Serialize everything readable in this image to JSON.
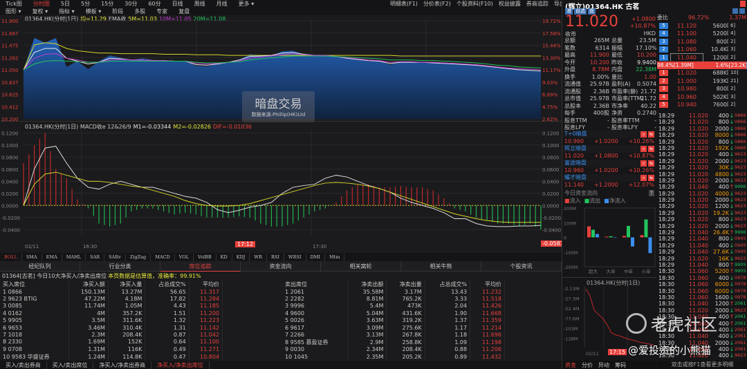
{
  "nav": {
    "tabs": [
      "Tick图",
      "分时图",
      "5日",
      "5分",
      "15分",
      "30分",
      "60分",
      "日线",
      "周线",
      "月线",
      "更多 ▾"
    ],
    "active": 1,
    "row2": [
      "图形 ▾",
      "复权 ▾",
      "指标 ▾",
      "模板 ▾",
      "阶段",
      "多股",
      "专家",
      "复盘"
    ],
    "right": [
      "明细表(F1)",
      "分价表(F2)",
      "个股资料(F10)",
      "权益披露",
      "券商追踪",
      "导出",
      ">>"
    ]
  },
  "price_chart": {
    "legend_code": "01364.HK(分时|1日)",
    "legend_avg": "均=11.29",
    "legend_ema": "EMA收",
    "legend_5m": "5M=11.03",
    "legend_10m": "10M=11.05",
    "legend_20m": "20M=11.08",
    "watermark_title": "暗盘交易",
    "watermark_sub": "数据来源:Phillip(HK)Ltd"
  },
  "macd": {
    "legend_code": "01364.HK(分时|1日) MACD收e 12&26/9",
    "m1": "M1=-0.03344",
    "m2": "M2=-0.02826",
    "dif": "DIF=-0.01036",
    "cursor_time": "17:12",
    "cursor_value": "-0.0581",
    "x_labels": [
      "02/11",
      "16:30",
      "17:30"
    ]
  },
  "chart_data": [
    {
      "type": "line",
      "title": "01364.HK 分时",
      "ylim": [
        10.2,
        11.9
      ],
      "yticks": [
        "11.900",
        "11.687",
        "11.475",
        "11.262",
        "11.050",
        "10.837",
        "10.625",
        "10.412",
        "10.200"
      ],
      "pct_ticks": [
        "19.72%",
        "17.58%",
        "15.44%",
        "13.30%",
        "11.17%",
        "9.03%",
        "6.89%",
        "4.75%",
        "2.62%"
      ],
      "series": [
        {
          "name": "price",
          "color": "#2f7fd6",
          "values": [
            11.05,
            11.6,
            11.52,
            11.6,
            11.1,
            11.2,
            11.06,
            11.2,
            11.3,
            11.26,
            11.22,
            11.25,
            11.22,
            11.21,
            11.2,
            11.2,
            11.12,
            11.11,
            11.15,
            11.18,
            11.22,
            11.32,
            11.3,
            11.29,
            11.37,
            11.38,
            11.32,
            11.3,
            11.3,
            11.29,
            11.25,
            11.24,
            11.2,
            11.2,
            11.14,
            11.19,
            11.19,
            11.19,
            11.18,
            11.17,
            11.16,
            11.15,
            11.14,
            11.12,
            11.1,
            11.08,
            11.06,
            11.05,
            11.03
          ]
        },
        {
          "name": "avg",
          "color": "#d6d62a",
          "values": [
            11.05,
            11.48,
            11.52,
            11.5,
            11.42,
            11.38,
            11.36,
            11.34,
            11.34,
            11.33,
            11.33,
            11.33,
            11.33,
            11.32,
            11.32,
            11.32,
            11.31,
            11.31,
            11.31,
            11.3,
            11.3,
            11.3,
            11.3,
            11.3,
            11.3,
            11.3,
            11.3,
            11.3,
            11.3,
            11.3,
            11.3,
            11.3,
            11.3,
            11.3,
            11.3,
            11.29,
            11.29,
            11.29,
            11.29,
            11.29,
            11.29,
            11.29,
            11.29,
            11.29,
            11.29,
            11.29,
            11.29,
            11.29,
            11.29
          ]
        },
        {
          "name": "5M",
          "color": "#e8e8e8",
          "values": [
            11.05,
            11.35,
            11.42,
            11.42,
            11.25,
            11.2,
            11.15,
            11.18,
            11.25,
            11.24,
            11.22,
            11.22,
            11.21,
            11.21,
            11.2,
            11.2,
            11.14,
            11.13,
            11.15,
            11.18,
            11.22,
            11.28,
            11.29,
            11.3,
            11.34,
            11.35,
            11.32,
            11.3,
            11.3,
            11.28,
            11.25,
            11.23,
            11.21,
            11.2,
            11.16,
            11.18,
            11.18,
            11.18,
            11.17,
            11.16,
            11.15,
            11.14,
            11.13,
            11.11,
            11.09,
            11.07,
            11.05,
            11.04,
            11.03
          ]
        },
        {
          "name": "10M",
          "color": "#c03ccf",
          "values": [
            11.05,
            11.25,
            11.32,
            11.33,
            11.25,
            11.22,
            11.18,
            11.18,
            11.22,
            11.23,
            11.22,
            11.22,
            11.21,
            11.21,
            11.2,
            11.2,
            11.16,
            11.15,
            11.16,
            11.18,
            11.2,
            11.25,
            11.27,
            11.29,
            11.31,
            11.33,
            11.31,
            11.3,
            11.3,
            11.28,
            11.26,
            11.24,
            11.22,
            11.21,
            11.18,
            11.19,
            11.19,
            11.18,
            11.18,
            11.17,
            11.16,
            11.15,
            11.14,
            11.12,
            11.1,
            11.08,
            11.07,
            11.06,
            11.05
          ]
        },
        {
          "name": "20M",
          "color": "#22c55e",
          "values": [
            11.05,
            11.15,
            11.2,
            11.21,
            11.2,
            11.19,
            11.18,
            11.18,
            11.2,
            11.2,
            11.2,
            11.2,
            11.2,
            11.2,
            11.2,
            11.2,
            11.18,
            11.17,
            11.17,
            11.18,
            11.19,
            11.22,
            11.24,
            11.26,
            11.27,
            11.29,
            11.29,
            11.29,
            11.29,
            11.28,
            11.27,
            11.26,
            11.25,
            11.24,
            11.22,
            11.22,
            11.22,
            11.21,
            11.21,
            11.2,
            11.19,
            11.18,
            11.17,
            11.15,
            11.13,
            11.12,
            11.1,
            11.09,
            11.08
          ]
        }
      ]
    },
    {
      "type": "bar+line",
      "title": "MACD",
      "ylim": [
        -0.05,
        0.12
      ],
      "yticks": [
        "0.1200",
        "0.1000",
        "0.0800",
        "0.0600",
        "0.0400",
        "0.0200",
        "0.0000",
        "-0.0200",
        "-0.0400"
      ],
      "hist": [
        0.07,
        0.1,
        0.12,
        0.06,
        0.045,
        0.01,
        -0.005,
        -0.03,
        -0.035,
        -0.03,
        -0.01,
        -0.005,
        -0.005,
        -0.01,
        -0.015,
        -0.012,
        -0.015,
        -0.02,
        -0.02,
        -0.02,
        -0.018,
        -0.02,
        -0.03,
        -0.035,
        -0.035,
        -0.03,
        -0.02,
        -0.01,
        -0.005,
        0.005,
        0.025,
        0.035,
        0.035,
        0.03,
        0.03,
        0.032,
        0.03,
        0.03,
        0.025,
        0.012,
        -0.005,
        -0.01,
        -0.02,
        -0.025,
        -0.03,
        -0.03,
        -0.035,
        -0.03,
        -0.04
      ],
      "dif": [
        0,
        0.06,
        0.095,
        0.098,
        0.07,
        0.045,
        0.03,
        0.027,
        0.035,
        0.04,
        0.035,
        0.03,
        0.03,
        0.025,
        0.02,
        0.015,
        0.012,
        0.005,
        -0.007,
        -0.012,
        -0.008,
        -0.003,
        0,
        0.005,
        0.02,
        0.03,
        0.033,
        0.035,
        0.045,
        0.05,
        0.047,
        0.04,
        0.033,
        0.028,
        0.022,
        0.012,
        0.005,
        0,
        -0.005,
        -0.012,
        -0.022,
        -0.022,
        -0.03,
        -0.034,
        -0.035,
        -0.035,
        -0.034,
        -0.034,
        -0.033
      ],
      "dea": [
        0,
        0.035,
        0.052,
        0.055,
        0.05,
        0.045,
        0.04,
        0.04,
        0.038,
        0.035,
        0.032,
        0.03,
        0.025,
        0.02,
        0.015,
        0.008,
        0.003,
        0,
        -0.001,
        -0.001,
        0,
        0.003,
        0.008,
        0.013,
        0.018,
        0.023,
        0.028,
        0.033,
        0.037,
        0.038,
        0.037,
        0.035,
        0.032,
        0.028,
        0.022,
        0.016,
        0.01,
        0.004,
        -0.002,
        -0.008,
        -0.014,
        -0.018,
        -0.022,
        -0.025,
        -0.027,
        -0.028,
        -0.028,
        -0.028,
        -0.028
      ]
    },
    {
      "type": "bar",
      "title": "今日资金流向",
      "categories": [
        "超大",
        "大单",
        "中单",
        "小单"
      ],
      "yticks": [
        "200M",
        "100M",
        "0",
        "-100M",
        "-200M"
      ],
      "ylim": [
        -200,
        200
      ],
      "series": [
        {
          "name": "流入",
          "color": "#e8413c",
          "values": [
            75,
            5,
            10,
            15
          ]
        },
        {
          "name": "流出",
          "color": "#22c55e",
          "values": [
            52,
            8,
            78,
            122
          ]
        },
        {
          "name": "净流入",
          "color": "#3b8ff0",
          "values": [
            23,
            -3,
            -62,
            -107
          ]
        }
      ]
    },
    {
      "type": "line",
      "title": "01364.HK(分时|1日)",
      "yticks": [
        "-2.13M",
        "-27.3M",
        "-52.4M",
        "-77.6M",
        "-103M",
        "-128M"
      ],
      "ylim": [
        -145,
        5
      ],
      "x_label": "02/11",
      "cursor_time": "17:15",
      "values": [
        -2,
        -20,
        -55,
        -65,
        -75,
        -90,
        -110,
        -115,
        -118,
        -122,
        -126,
        -128,
        -131,
        -134,
        -136,
        -138,
        -140
      ]
    }
  ],
  "indicators": [
    "BOLL",
    "SMA",
    "EMA",
    "MAHL",
    "SAR",
    "SARv",
    "ZigZag",
    "MACD",
    "VOL",
    "VolBB",
    "KD",
    "KDJ",
    "WR",
    "RSI",
    "WRSI",
    "DMI",
    "Mtm"
  ],
  "sections": [
    "经纪队列",
    "行业分类",
    "席位追踪",
    "资金流向",
    "相关窝轮",
    "相关牛熊",
    "个股资讯"
  ],
  "seat": {
    "info": "01364[古茗] 今日10大净买入/净卖出席位",
    "notice": "本页数据是估算值，准确率：99.91%",
    "buy_headers": [
      "买入席位",
      "净买入额",
      "净买入量",
      "占总成交%",
      "平均价"
    ],
    "buy": [
      [
        "1  0866",
        "150.13M",
        "13.27M",
        "56.65",
        "11.317"
      ],
      [
        "2  9623  BTIG",
        "47.22M",
        "4.18M",
        "17.82",
        "11.284"
      ],
      [
        "3  0085",
        "11.74M",
        "1.05M",
        "4.43",
        "11.185"
      ],
      [
        "4  0162",
        "4M",
        "357.2K",
        "1.51",
        "11.200"
      ],
      [
        "5  9905",
        "3.5M",
        "311.6K",
        "1.32",
        "11.223"
      ],
      [
        "6  9653",
        "3.46M",
        "310.4K",
        "1.31",
        "11.142"
      ],
      [
        "7  1018",
        "2.3M",
        "208.4K",
        "0.87",
        "11.042"
      ],
      [
        "8  2330",
        "1.69M",
        "152K",
        "0.64",
        "11.100"
      ],
      [
        "9  0708",
        "1.31M",
        "116K",
        "0.49",
        "11.271"
      ],
      [
        "10  9583  华盛证券",
        "1.24M",
        "114.8K",
        "0.47",
        "10.804"
      ]
    ],
    "sell_headers": [
      "卖出席位",
      "净卖出额",
      "净卖出量",
      "占总成交%",
      "平均价"
    ],
    "sell": [
      [
        "1  2061",
        "35.58M",
        "3.17M",
        "13.43",
        "11.232"
      ],
      [
        "2  2282",
        "8.81M",
        "765.2K",
        "3.33",
        "11.518"
      ],
      [
        "3  9996",
        "5.4M",
        "473K",
        "2.04",
        "11.426"
      ],
      [
        "4  9600",
        "5.04M",
        "431.6K",
        "1.90",
        "11.668"
      ],
      [
        "5  0026",
        "3.63M",
        "319.2K",
        "1.37",
        "11.359"
      ],
      [
        "6  9617",
        "3.09M",
        "275.6K",
        "1.17",
        "11.214"
      ],
      [
        "7  2266",
        "3.13M",
        "267.8K",
        "1.18",
        "11.696"
      ],
      [
        "8  9585  慕盈证券",
        "2.9M",
        "258.8K",
        "1.09",
        "11.198"
      ],
      [
        "9  0030",
        "2.34M",
        "208.4K",
        "0.88",
        "11.206"
      ],
      [
        "10  1045",
        "2.35M",
        "205.2K",
        "0.89",
        "11.432"
      ]
    ],
    "bottom_tabs": [
      "买入/卖出券商",
      "买入/卖出席位",
      "净买入/净卖出券商",
      "净买入/净卖出席位"
    ]
  },
  "quote": {
    "title": "(辉立)01364.HK  古茗",
    "tags": [
      "港",
      "自选",
      "盘"
    ],
    "price": "11.020",
    "change": "+1.0800",
    "change_pct": "+10.87%",
    "status": "收市",
    "currency": "HKD",
    "stats": [
      [
        "总额",
        "265M",
        "总量",
        "23.5M"
      ],
      [
        "笔数",
        "6314",
        "振幅",
        "17.10%"
      ],
      [
        "最高",
        "11.900",
        "最低",
        "10.200"
      ],
      [
        "今开",
        "10.200",
        "昨收",
        "9.9400"
      ],
      [
        "外盘",
        "8.78M",
        "内盘",
        "22.38M"
      ],
      [
        "换手",
        "1.00%",
        "量比",
        "1.00"
      ],
      [
        "流通值",
        "25.97B",
        "盈利(A)",
        "0.5074"
      ],
      [
        "流通股",
        "2.36B",
        "市盈率(静)",
        "21.72"
      ],
      [
        "总市值",
        "25.97B",
        "市盈率(TTM)",
        "21.72"
      ],
      [
        "总股本",
        "2.36B",
        "市净率",
        "40.22"
      ],
      [
        "每手",
        "400股",
        "净资",
        "0.2740"
      ],
      [
        "股息TTM",
        "-",
        "股息率TTM",
        "-"
      ],
      [
        "股息LFY",
        "-",
        "股息率LFY",
        "-"
      ]
    ],
    "ratio_label": "委比",
    "ratio": "96.72%",
    "ratio_vol": "1.37M",
    "asks": [
      [
        "5",
        "11.120",
        "5600",
        "[ 6]"
      ],
      [
        "4",
        "11.100",
        "5200",
        "[ 4]"
      ],
      [
        "3",
        "11.080",
        "800",
        "[ 2]"
      ],
      [
        "2",
        "11.060",
        "10.4K",
        "[ 3]"
      ],
      [
        "1",
        "11.040",
        "1200",
        "[ 2]"
      ]
    ],
    "bar_left": "98.4%[1.39M]",
    "bar_right": "1.6%[23.2K]",
    "buy_share": 0.984,
    "bids": [
      [
        "1",
        "11.020",
        "688K",
        "[ 10]"
      ],
      [
        "2",
        "11.000",
        "193K",
        "[ 21]"
      ],
      [
        "3",
        "10.980",
        "800",
        "[ 2]"
      ],
      [
        "4",
        "10.960",
        "502K",
        "[ 3]"
      ],
      [
        "5",
        "10.940",
        "7600",
        "[ 2]"
      ]
    ]
  },
  "grey": [
    [
      "T+0暗盘",
      "10.960",
      "+1.0200",
      "+10.26%"
    ],
    [
      "辉立暗盘",
      "11.020",
      "+1.0800",
      "+10.87%"
    ],
    [
      "富途暗盘",
      "10.960",
      "+1.0200",
      "+10.26%"
    ],
    [
      "耀才暗盘",
      "11.140",
      "+1.2000",
      "+12.07%"
    ]
  ],
  "flow": {
    "title": "今日资金流向",
    "help": "?",
    "legend": [
      "流入",
      "流出",
      "净流入"
    ]
  },
  "trades": [
    [
      "18:29",
      "11.020",
      "400",
      "d",
      "0866"
    ],
    [
      "18:29",
      "11.020",
      "800",
      "d",
      "0866"
    ],
    [
      "18:29",
      "11.020",
      "2000",
      "d",
      "0866"
    ],
    [
      "18:29",
      "11.020",
      "8000",
      "d",
      "0866"
    ],
    [
      "18:29",
      "11.020",
      "800",
      "d",
      "0866"
    ],
    [
      "18:29",
      "11.020",
      "192K",
      "d",
      "0866"
    ],
    [
      "18:29",
      "11.020",
      "400",
      "d",
      "9623"
    ],
    [
      "18:29",
      "11.020",
      "2000",
      "d",
      "9623"
    ],
    [
      "18:29",
      "11.020",
      "30K",
      "d",
      "9623"
    ],
    [
      "18:29",
      "11.020",
      "4800",
      "d",
      "9623"
    ],
    [
      "18:29",
      "11.020",
      "2000",
      "d",
      "9623"
    ],
    [
      "18:29",
      "11.040",
      "400",
      "u",
      "9996"
    ],
    [
      "18:29",
      "11.020",
      "4000",
      "d",
      "9623"
    ],
    [
      "18:29",
      "11.020",
      "2000",
      "d",
      "9623"
    ],
    [
      "18:29",
      "11.020",
      "1200",
      "d",
      "9623"
    ],
    [
      "18:29",
      "11.020",
      "19.2K",
      "d",
      "9623"
    ],
    [
      "18:29",
      "11.020",
      "800",
      "d",
      "9623"
    ],
    [
      "18:29",
      "11.020",
      "2000",
      "d",
      "9623"
    ],
    [
      "18:29",
      "11.040",
      "26.4K",
      "u",
      "9996"
    ],
    [
      "18:29",
      "11.040",
      "800",
      "d",
      "0945"
    ],
    [
      "18:29",
      "11.040",
      "400",
      "d",
      "0945"
    ],
    [
      "18:29",
      "11.040",
      "27.6K",
      "d",
      "0945"
    ],
    [
      "18:29",
      "11.020",
      "16K",
      "d",
      "9623"
    ],
    [
      "18:29",
      "11.040",
      "800",
      "u",
      "9905"
    ],
    [
      "18:30",
      "11.060",
      "5200",
      "u",
      "9905"
    ],
    [
      "18:30",
      "11.060",
      "400",
      "d",
      "0978"
    ],
    [
      "18:30",
      "11.060",
      "6000",
      "d",
      "0978"
    ],
    [
      "18:30",
      "11.060",
      "6000",
      "d",
      "0978"
    ],
    [
      "18:30",
      "11.060",
      "1600",
      "d",
      "0978"
    ],
    [
      "18:30",
      "11.040",
      "1200",
      "u",
      "2061"
    ],
    [
      "18:30",
      "11.020",
      "2000",
      "d",
      "9623"
    ],
    [
      "18:30",
      "11.040",
      "400",
      "u",
      "2061"
    ],
    [
      "18:30",
      "11.040",
      "400",
      "u",
      "2061"
    ],
    [
      "18:30",
      "11.040",
      "400",
      "d",
      "2061"
    ],
    [
      "18:30",
      "11.040",
      "400",
      "d",
      "2061"
    ],
    [
      "18:30",
      "11.040",
      "2000",
      "d",
      "2061"
    ],
    [
      "18:30",
      "11.040",
      "400",
      "d",
      "2061"
    ],
    [
      "18:30",
      "11.020",
      "400",
      "d",
      "9623"
    ]
  ],
  "bottom_right": {
    "tabs": [
      "资金",
      "分价",
      "异动",
      "筹码"
    ],
    "hint": "双击或按F1查看更多明细"
  },
  "watermark": {
    "brand": "老虎社区",
    "user": "@爱投资的小熊猫"
  }
}
